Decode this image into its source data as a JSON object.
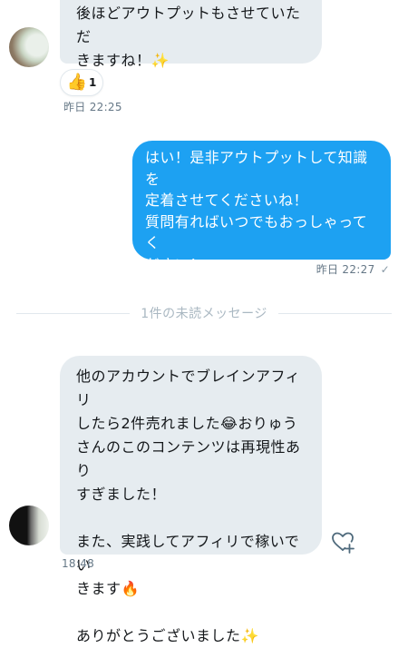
{
  "messages": {
    "first": {
      "text": "後ほどアウトプットもさせていただ\nきますね！✨",
      "time": "昨日 22:25",
      "reaction": {
        "emoji": "👍",
        "count": "1"
      }
    },
    "outgoing": {
      "text": "はい！是非アウトプットして知識を\n定着させてくださいね！\n質問有ればいつでもおっしゃってく\nださい！\nよろしくお願いします😌",
      "time": "昨日 22:27"
    },
    "divider": "1件の未読メッセージ",
    "second": {
      "text": "他のアカウントでブレインアフィリ\nしたら2件売れました😂おりゅう\nさんのこのコンテンツは再現性あり\nすぎました！\n\nまた、実践してアフィリで稼いでい\nきます🔥\n\nありがとうございました✨",
      "time": "18:48"
    }
  },
  "icons": {
    "read_check": "checkmark-icon",
    "like_add": "heart-plus-icon"
  },
  "colors": {
    "outgoing_bubble": "#1da1f2",
    "incoming_bubble": "#e6ecf0",
    "timestamp": "#657786"
  }
}
